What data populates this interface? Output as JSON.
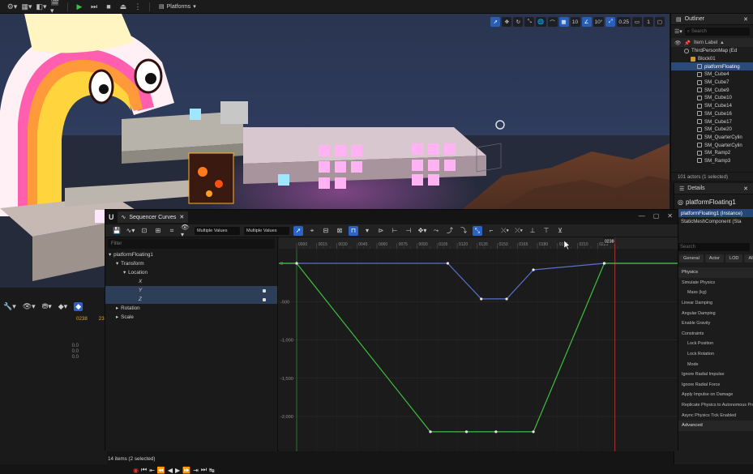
{
  "topbar": {
    "platforms_label": "Platforms"
  },
  "viewport": {
    "toolbar": {
      "grid": "10",
      "angle": "10°",
      "scale": "0.25",
      "camera": "1"
    }
  },
  "outliner": {
    "tab_label": "Outliner",
    "search_placeholder": "Search",
    "column_label": "Item Label",
    "rows": [
      {
        "label": "ThirdPersonMap (Ed",
        "icon": "world-icon",
        "selected": false,
        "indent": 1
      },
      {
        "label": "Block01",
        "icon": "folder-icon",
        "selected": false,
        "indent": 2
      },
      {
        "label": "platformFloating",
        "icon": "actor-icon",
        "selected": true,
        "indent": 3
      },
      {
        "label": "SM_Cube4",
        "icon": "actor-icon",
        "selected": false,
        "indent": 3
      },
      {
        "label": "SM_Cube7",
        "icon": "actor-icon",
        "selected": false,
        "indent": 3
      },
      {
        "label": "SM_Cube9",
        "icon": "actor-icon",
        "selected": false,
        "indent": 3
      },
      {
        "label": "SM_Cube10",
        "icon": "actor-icon",
        "selected": false,
        "indent": 3
      },
      {
        "label": "SM_Cube14",
        "icon": "actor-icon",
        "selected": false,
        "indent": 3
      },
      {
        "label": "SM_Cube16",
        "icon": "actor-icon",
        "selected": false,
        "indent": 3
      },
      {
        "label": "SM_Cube17",
        "icon": "actor-icon",
        "selected": false,
        "indent": 3
      },
      {
        "label": "SM_Cube20",
        "icon": "actor-icon",
        "selected": false,
        "indent": 3
      },
      {
        "label": "SM_QuarterCylin",
        "icon": "actor-icon",
        "selected": false,
        "indent": 3
      },
      {
        "label": "SM_QuarterCylin",
        "icon": "actor-icon",
        "selected": false,
        "indent": 3
      },
      {
        "label": "SM_Ramp2",
        "icon": "actor-icon",
        "selected": false,
        "indent": 3
      },
      {
        "label": "SM_Ramp3",
        "icon": "actor-icon",
        "selected": false,
        "indent": 3
      }
    ],
    "footer": "101 actors (1 selected)"
  },
  "details": {
    "tab_label": "Details",
    "title": "platformFloating1",
    "components": [
      {
        "label": "platformFloating1 (Instance)",
        "selected": true
      },
      {
        "label": "StaticMeshComponent (Sta",
        "selected": false
      }
    ],
    "search_placeholder": "Search",
    "tabs": [
      "General",
      "Actor",
      "LOD",
      "All"
    ],
    "properties": [
      {
        "label": "Physics",
        "type": "cat"
      },
      {
        "label": "Simulate Physics",
        "type": "prop"
      },
      {
        "label": "Mass (kg)",
        "type": "ind"
      },
      {
        "label": "Linear Damping",
        "type": "prop"
      },
      {
        "label": "Angular Damping",
        "type": "prop"
      },
      {
        "label": "Enable Gravity",
        "type": "prop"
      },
      {
        "label": "Constraints",
        "type": "prop"
      },
      {
        "label": "Lock Position",
        "type": "ind"
      },
      {
        "label": "Lock Rotation",
        "type": "ind"
      },
      {
        "label": "Mode",
        "type": "ind"
      },
      {
        "label": "Ignore Radial Impulse",
        "type": "prop"
      },
      {
        "label": "Ignore Radial Force",
        "type": "prop"
      },
      {
        "label": "Apply Impulse on Damage",
        "type": "prop"
      },
      {
        "label": "Replicate Physics to Autonomous Prox",
        "type": "prop"
      },
      {
        "label": "Async Physics Tick Enabled",
        "type": "prop"
      },
      {
        "label": "Advanced",
        "type": "cat"
      }
    ]
  },
  "lower_left": {
    "frame_a": "0238",
    "frame_b": "23",
    "values": [
      "0.0",
      "0.0",
      "0.0"
    ]
  },
  "sequencer": {
    "tab_label": "Sequencer Curves",
    "field_a": "Multiple Values",
    "field_b": "Multiple Values",
    "filter_placeholder": "Filter",
    "tree": [
      {
        "label": "platformFloating1",
        "depth": 0,
        "arrow": "▾",
        "selected": false,
        "key": false
      },
      {
        "label": "Transform",
        "depth": 1,
        "arrow": "▾",
        "selected": false,
        "key": false
      },
      {
        "label": "Location",
        "depth": 2,
        "arrow": "▾",
        "selected": false,
        "key": false
      },
      {
        "label": "X",
        "depth": 3,
        "arrow": "",
        "selected": false,
        "key": false
      },
      {
        "label": "Y",
        "depth": 3,
        "arrow": "",
        "selected": true,
        "key": true
      },
      {
        "label": "Z",
        "depth": 3,
        "arrow": "",
        "selected": true,
        "key": true
      },
      {
        "label": "Rotation",
        "depth": 1,
        "arrow": "▸",
        "selected": false,
        "key": false
      },
      {
        "label": "Scale",
        "depth": 1,
        "arrow": "▸",
        "selected": false,
        "key": false
      }
    ],
    "footer": "14 items (2 selected)",
    "current_frame": "0238",
    "ruler_ticks": [
      "0000",
      "0015",
      "0030",
      "0045",
      "0060",
      "0075",
      "0090",
      "0105",
      "0120",
      "0135",
      "0150",
      "0165",
      "0180",
      "0195",
      "0210",
      "0225"
    ],
    "y_labels": [
      "0",
      "-500",
      "-1,000",
      "-1,500",
      "-2,000"
    ],
    "curves": [
      {
        "name": "Y",
        "color": "#5b6fc8",
        "keys": [
          [
            0,
            0
          ],
          [
            113,
            0
          ],
          [
            138,
            -465
          ],
          [
            157,
            -465
          ],
          [
            177,
            -85
          ],
          [
            230,
            0
          ]
        ]
      },
      {
        "name": "Z",
        "color": "#3ebf3e",
        "keys": [
          [
            0,
            0
          ],
          [
            100,
            -2200
          ],
          [
            127,
            -2200
          ],
          [
            149,
            -2200
          ],
          [
            177,
            -2200
          ],
          [
            230,
            0
          ]
        ]
      }
    ]
  },
  "colors": {
    "accent": "#2b63c6",
    "selection": "#2a4a78",
    "curve_y": "#5b6fc8",
    "curve_z": "#3ebf3e"
  }
}
